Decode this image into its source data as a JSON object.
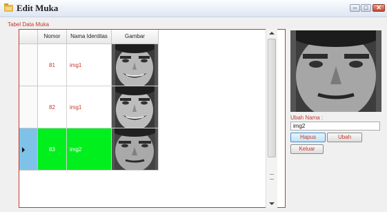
{
  "window": {
    "title": "Edit Muka",
    "minimize_glyph": "–",
    "maximize_glyph": "□",
    "close_glyph": "✕"
  },
  "group": {
    "label": "Tabel Data Muka"
  },
  "table": {
    "columns": [
      "Nomor",
      "Nama Identitas",
      "Gambar"
    ],
    "rows": [
      {
        "nomor": "81",
        "nama": "img1",
        "face_icon": "face-smiling-icon",
        "selected": false
      },
      {
        "nomor": "82",
        "nama": "img1",
        "face_icon": "face-smiling-icon",
        "selected": false
      },
      {
        "nomor": "83",
        "nama": "img2",
        "face_icon": "face-neutral-icon",
        "selected": true
      }
    ],
    "selected_row_color": "#00ef1d"
  },
  "form": {
    "rename_label": "Ubah Nama :",
    "rename_value": "img2",
    "delete_label": "Hapus",
    "update_label": "Ubah",
    "exit_label": "Keluar"
  },
  "colors": {
    "accent_text": "#c0392b",
    "selection_header": "#7fc2e8"
  }
}
